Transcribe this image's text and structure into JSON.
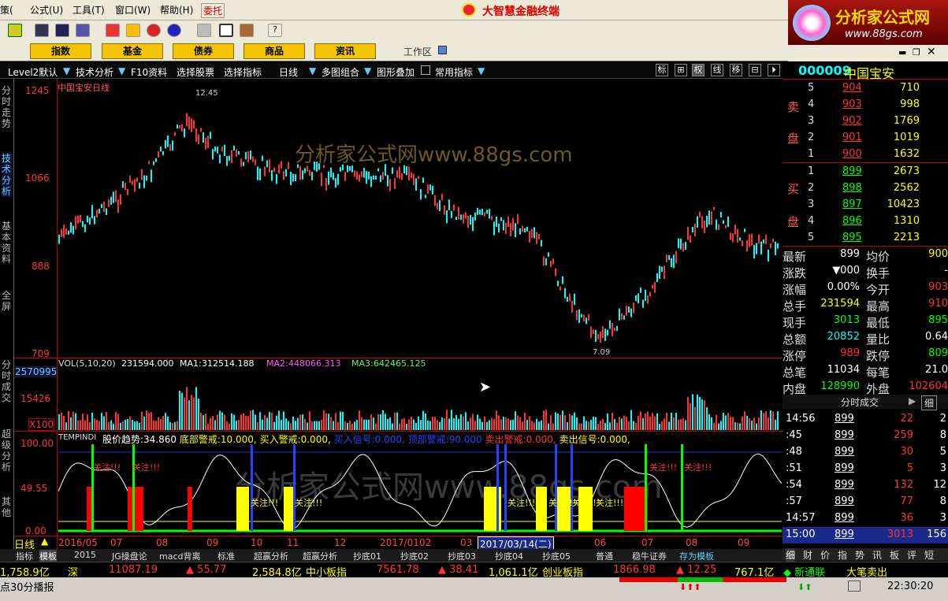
{
  "window": {
    "title": "大智慧金融终端"
  },
  "menubar": {
    "items": [
      "策(",
      "公式(U)",
      "工具(T)",
      "窗口(W)",
      "帮助(H)",
      "委托"
    ]
  },
  "toolbar": {
    "icons": [
      "flag-icon",
      "binoculars-icon",
      "binoculars-icon",
      "delete-icon",
      "diamond-icon",
      "link-icon",
      "refresh-icon",
      "folder-icon",
      "layout-icon",
      "books-icon",
      "help-pointer-icon"
    ]
  },
  "main_tabs": [
    "指数",
    "基金",
    "债券",
    "商品",
    "资讯"
  ],
  "workspace": {
    "label": "工作区"
  },
  "logo": {
    "text": "分析家公式网",
    "url": "www.88gs.com"
  },
  "options": {
    "items": [
      "Level2默认",
      "技术分析",
      "F10资料",
      "选择股票",
      "选择指标",
      "日线",
      "多图组合",
      "图形叠加",
      "常用指标"
    ],
    "right_icons": [
      "标",
      "⊞",
      "权",
      "线",
      "移",
      "⊟",
      "⏵"
    ]
  },
  "sidenav": {
    "items": [
      "分时走势",
      "技术分析",
      "基本资料",
      "全屏",
      "分时成交",
      "超级分析",
      "其他"
    ]
  },
  "stock": {
    "code": "000009",
    "name": "中国宝安",
    "chart_caption": "中国宝安日线"
  },
  "price_chart": {
    "axis": [
      "1245",
      "1066",
      "888",
      "709"
    ],
    "high_label": "12.45",
    "low_label": "7.09"
  },
  "volume": {
    "caption": "VOL(5,10,20)",
    "vol": "231594.000",
    "ma1_l": "MA1:",
    "ma1": "312514.188",
    "ma2_l": "MA2:",
    "ma2": "448066.313",
    "ma3_l": "MA3:",
    "ma3": "642465.125",
    "axis": [
      "2570995",
      "15426",
      "X100"
    ]
  },
  "indicator": {
    "caption": "TEMPINDI",
    "items": [
      {
        "label": "股价趋势:",
        "value": "34.860"
      },
      {
        "label": "底部警戒:",
        "value": "10.000,"
      },
      {
        "label": "买入警戒:",
        "value": "0.000,"
      },
      {
        "label": "买入信号:",
        "value": "0.000,"
      },
      {
        "label": "顶部警戒:",
        "value": "90.000"
      },
      {
        "label": "卖出警戒:",
        "value": "0.000,"
      },
      {
        "label": "卖出信号:",
        "value": "0.000,"
      }
    ],
    "axis": [
      "100.00",
      "49.55",
      "0.00"
    ],
    "notes": [
      "关注!!!",
      "关注!!!",
      "关注!!!",
      "关注!!!",
      "关注!!!",
      "关注!!!",
      "关注!!!",
      "关注!!!",
      "关注!!!",
      "关注!!!"
    ]
  },
  "timeline": {
    "period": "日线",
    "labels": [
      "2016/05",
      "07",
      "08",
      "09",
      "10",
      "11",
      "12",
      "2017/01",
      "02",
      "03",
      "2017/03/14(二)",
      "06",
      "07",
      "08",
      "09"
    ]
  },
  "bottom_tabs": [
    "指标",
    "模板",
    "2015",
    "JG操盘论",
    "macd背离",
    "标准",
    "超赢分析",
    "超赢分析",
    "抄底01",
    "抄底02",
    "抄底03",
    "抄底04",
    "抄底05",
    "普通",
    "稳牛证券",
    "存为模板"
  ],
  "orderbook": {
    "sell_label": [
      "卖",
      "盘"
    ],
    "buy_label": [
      "买",
      "盘"
    ],
    "sell": [
      {
        "n": "5",
        "price": "904",
        "vol": "710"
      },
      {
        "n": "4",
        "price": "903",
        "vol": "998"
      },
      {
        "n": "3",
        "price": "902",
        "vol": "1769"
      },
      {
        "n": "2",
        "price": "901",
        "vol": "1019"
      },
      {
        "n": "1",
        "price": "900",
        "vol": "1632"
      }
    ],
    "buy": [
      {
        "n": "1",
        "price": "899",
        "vol": "2673"
      },
      {
        "n": "2",
        "price": "898",
        "vol": "2562"
      },
      {
        "n": "3",
        "price": "897",
        "vol": "10423"
      },
      {
        "n": "4",
        "price": "896",
        "vol": "1310"
      },
      {
        "n": "5",
        "price": "895",
        "vol": "2213"
      }
    ]
  },
  "quote": {
    "rows": [
      [
        "最新",
        "899",
        "均价",
        "900"
      ],
      [
        "涨跌",
        "▼000",
        "换手",
        "-"
      ],
      [
        "涨幅",
        "0.00%",
        "今开",
        "903"
      ],
      [
        "总手",
        "231594",
        "最高",
        "910"
      ],
      [
        "现手",
        "3013",
        "最低",
        "895"
      ],
      [
        "总额",
        "20852",
        "量比",
        "0.64"
      ],
      [
        "涨停",
        "989",
        "跌停",
        "809"
      ],
      [
        "总笔",
        "11034",
        "每笔",
        "21.0"
      ],
      [
        "内盘",
        "128990",
        "外盘",
        "102604"
      ]
    ]
  },
  "ticks": {
    "title": "分时成交",
    "detail_btn": "细",
    "rows": [
      [
        "14:56",
        "899",
        "22",
        "2"
      ],
      [
        ":45",
        "899",
        "259",
        "8"
      ],
      [
        ":48",
        "899",
        "30",
        "5"
      ],
      [
        ":51",
        "899",
        "5",
        "3"
      ],
      [
        ":54",
        "899",
        "132",
        "12"
      ],
      [
        ":57",
        "899",
        "77",
        "8"
      ],
      [
        "14:57",
        "899",
        "36",
        "3"
      ],
      [
        "15:00",
        "899",
        "3013",
        "156"
      ]
    ],
    "tabs": [
      "细",
      "财",
      "价",
      "指",
      "势",
      "讯",
      "板",
      "评",
      "短"
    ]
  },
  "index_bar": {
    "items": [
      "1,758.9亿",
      "深",
      "11087.19",
      "▲ 55.77",
      "2,584.8亿",
      "中小板指",
      "7561.78",
      "▲ 38.41",
      "1,061.1亿",
      "创业板指",
      "1866.98",
      "▲ 12.25",
      "767.1亿",
      "◆ 新通联",
      "大笔卖出"
    ]
  },
  "status": {
    "left": "点30分播报",
    "time": "22:30:20"
  },
  "watermark": {
    "top": "分析家公式网www.88gs.com",
    "bottom": "分析家公式网www.88gs.com"
  },
  "colors": {
    "up": "#ff3333",
    "down": "#00ffff",
    "yellow": "#ffff00",
    "cyan": "#00ffff",
    "green": "#00ff00",
    "magenta": "#ff00ff"
  }
}
